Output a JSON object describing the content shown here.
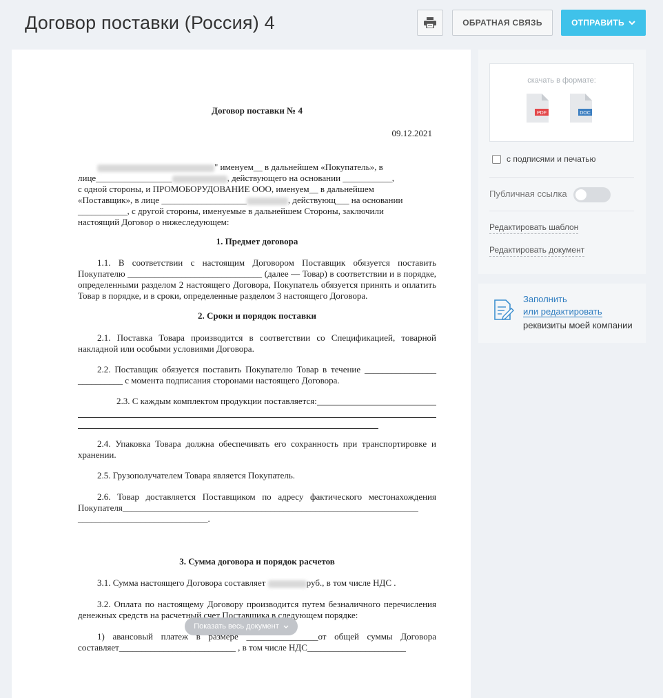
{
  "header": {
    "title": "Договор поставки (Россия) 4",
    "print_icon": "printer-icon",
    "feedback_label": "ОБРАТНАЯ СВЯЗЬ",
    "send_label": "ОТПРАВИТЬ",
    "send_icon": "chevron-down-icon",
    "accent_color": "#3fc2ea"
  },
  "document": {
    "title": "Договор поставки № 4",
    "date": "09.12.2021",
    "intro": {
      "l1": "\" именуем__ в дальнейшем «Покупатель», в",
      "l2": "лице_________________",
      "l2b": ", действующего на основании ___________,",
      "l3": "с одной стороны, и ПРОМОБОРУДОВАНИЕ ООО, именуем__ в дальнейшем",
      "l4": "«Поставщик», в лице ___________________",
      "l4b": ", действующ___ на основании",
      "l5": "___________, с другой стороны, именуемые в дальнейшем Стороны, заключили",
      "l6": "настоящий Договор о нижеследующем:"
    },
    "s1_heading": "1. Предмет договора",
    "p11": "1.1. В соответствии с настоящим Договором Поставщик обязуется поставить Покупателю ______________________________ (далее — Товар) в соответствии и в порядке, определенными разделом 2 настоящего Договора, Покупатель обязуется принять и оплатить Товар в порядке, и в сроки, определенные разделом 3 настоящего Договора.",
    "s2_heading": "2. Сроки и порядок поставки",
    "p21": "2.1. Поставка Товара производится в соответствии со Спецификацией, товарной накладной или особыми условиями Договора.",
    "p22": "2.2. Поставщик обязуется поставить Покупателю Товар в течение ________________ __________ с момента подписания сторонами настоящего Договора.",
    "p23": "2.3. С каждым комплектом продукции поставляется:",
    "p24": "2.4. Упаковка Товара должна обеспечивать его сохранность при транспортировке и хранении.",
    "p25": "2.5. Грузополучателем Товара является Покупатель.",
    "p26": "2.6. Товар доставляется Поставщиком по адресу фактического местонахождения Покупателя__________________________________________________________________ _____________________________.",
    "s3_heading": "3. Сумма договора и порядок расчетов",
    "p31a": "3.1. Сумма настоящего Договора составляет",
    "p31b": "руб., в том числе НДС .",
    "p32": "3.2. Оплата по настоящему Договору производится путем безналичного перечисления денежных средств на расчетный счет Поставщика в следующем порядке:",
    "p33": "1) авансовый платеж в размере ________________от общей суммы Договора составляет__________________________ , в том числе НДС______________________"
  },
  "show_all_label": "Показать весь документ",
  "download": {
    "label": "скачать в формате:",
    "pdf_label": "PDF",
    "doc_label": "DOC",
    "pdf_color": "#e3484a",
    "doc_color": "#3d7fc1"
  },
  "sidebar": {
    "checkbox_label": "с подписями и печатью",
    "public_link_label": "Публичная ссылка",
    "public_link_on": false,
    "edit_template": "Редактировать шаблон",
    "edit_document": "Редактировать документ"
  },
  "company": {
    "fill_link": "Заполнить",
    "edit_link": "или редактировать",
    "details_text": "реквизиты моей компании"
  }
}
